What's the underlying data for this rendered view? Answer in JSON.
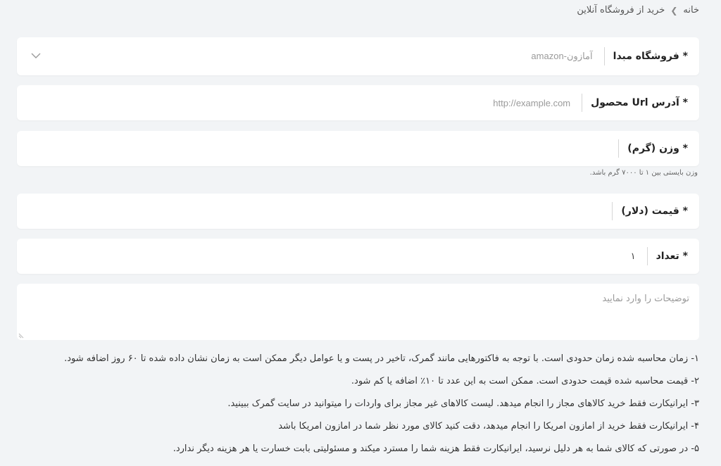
{
  "breadcrumb": {
    "home": "خانه",
    "current": "خرید از فروشگاه آنلاین"
  },
  "form": {
    "store": {
      "label": "* فروشگاه مبدا",
      "value": "آمازون-amazon"
    },
    "url": {
      "label": "* آدرس Url محصول",
      "placeholder": "http://example.com"
    },
    "weight": {
      "label": "* وزن (گرم)",
      "hint": "وزن بایستی بین ۱ تا ۷۰۰۰ گرم باشد."
    },
    "price": {
      "label": "* قیمت (دلار)"
    },
    "quantity": {
      "label": "* تعداد",
      "value": "۱"
    },
    "description": {
      "placeholder": "توضیحات را وارد نمایید"
    }
  },
  "notes": [
    "۱- زمان محاسبه شده زمان حدودی است. با توجه به فاکتورهایی مانند گمرک، تاخیر در پست و یا عوامل دیگر ممکن است به زمان نشان داده شده تا ۶۰ روز اضافه شود.",
    "۲- قیمت محاسبه شده قیمت حدودی است. ممکن است به این عدد تا ۱۰٪ اضافه یا کم شود.",
    "۳- ایرانیکارت فقط خرید کالاهای مجاز را انجام میدهد. لیست کالاهای غیر مجاز برای واردات را میتوانید در سایت گمرک ببینید.",
    "۴- ایرانیکارت فقط خرید از امازون امریکا را انجام میدهد، دقت کنید کالای مورد نظر شما در امازون امریکا باشد",
    "۵- در صورتی که کالای شما به هر دلیل نرسید، ایرانیکارت فقط هزینه شما را مسترد میکند و مسئولیتی بابت خسارت یا هر هزینه دیگر ندارد."
  ]
}
